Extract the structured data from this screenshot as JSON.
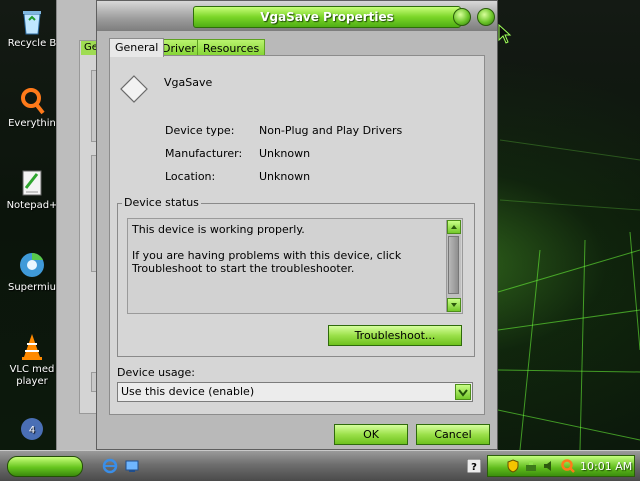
{
  "desktop": {
    "icons": [
      {
        "label": "Recycle B"
      },
      {
        "label": "Everythin"
      },
      {
        "label": "Notepad+"
      },
      {
        "label": "Supermiu"
      },
      {
        "label": "VLC med player"
      }
    ]
  },
  "back_window": {
    "tab_label": "Gen"
  },
  "dialog": {
    "title": "VgaSave Properties",
    "tabs": [
      {
        "label": "General",
        "active": true
      },
      {
        "label": "Driver",
        "active": false
      },
      {
        "label": "Resources",
        "active": false
      }
    ],
    "device_name": "VgaSave",
    "fields": [
      {
        "label": "Device type:",
        "value": "Non-Plug and Play Drivers"
      },
      {
        "label": "Manufacturer:",
        "value": "Unknown"
      },
      {
        "label": "Location:",
        "value": "Unknown"
      }
    ],
    "status_group_label": "Device status",
    "status_line1": "This device is working properly.",
    "status_line2": "If you are having problems with this device, click Troubleshoot to start the troubleshooter.",
    "troubleshoot_label": "Troubleshoot...",
    "usage_label": "Device usage:",
    "usage_value": "Use this device (enable)",
    "ok_label": "OK",
    "cancel_label": "Cancel"
  },
  "taskbar": {
    "clock": "10:01 AM"
  },
  "colors": {
    "accent_green": "#7bd628",
    "dialog_gray": "#b9b9b9",
    "panel_gray": "#d6d6d6"
  }
}
